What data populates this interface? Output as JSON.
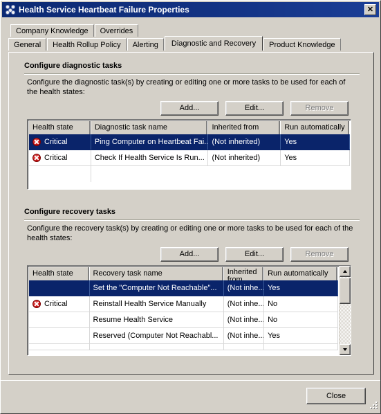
{
  "window": {
    "title": "Health Service Heartbeat Failure Properties",
    "icon": "management-pack-icon",
    "close_label": "✕"
  },
  "tabs": {
    "row1": [
      {
        "label": "Company Knowledge",
        "selected": false
      },
      {
        "label": "Overrides",
        "selected": false
      }
    ],
    "row2": [
      {
        "label": "General",
        "selected": false
      },
      {
        "label": "Health Rollup Policy",
        "selected": false
      },
      {
        "label": "Alerting",
        "selected": false
      },
      {
        "label": "Diagnostic and Recovery",
        "selected": true
      },
      {
        "label": "Product Knowledge",
        "selected": false
      }
    ]
  },
  "diagnostic": {
    "section_title": "Configure diagnostic tasks",
    "description": "Configure the diagnostic task(s) by creating or editing one or more tasks to be used for each of the health states:",
    "buttons": {
      "add": "Add...",
      "edit": "Edit...",
      "remove": "Remove"
    },
    "columns": [
      "Health state",
      "Diagnostic task name",
      "Inherited from",
      "Run automatically"
    ],
    "rows": [
      {
        "health_state": "Critical",
        "has_icon": true,
        "task_name": "Ping Computer on Heartbeat Fai...",
        "inherited_from": "(Not inherited)",
        "run_automatically": "Yes",
        "selected": true
      },
      {
        "health_state": "Critical",
        "has_icon": true,
        "task_name": "Check If Health Service Is Run...",
        "inherited_from": "(Not inherited)",
        "run_automatically": "Yes",
        "selected": false
      }
    ]
  },
  "recovery": {
    "section_title": "Configure recovery tasks",
    "description": "Configure the recovery task(s) by creating or editing one or more tasks to be used for each of the health states:",
    "buttons": {
      "add": "Add...",
      "edit": "Edit...",
      "remove": "Remove"
    },
    "columns": [
      "Health state",
      "Recovery task name",
      "Inherited from",
      "Run automatically"
    ],
    "rows": [
      {
        "health_state": "",
        "has_icon": false,
        "task_name": "Set the \"Computer Not Reachable\"...",
        "inherited_from": "(Not inhe...",
        "run_automatically": "Yes",
        "selected": true
      },
      {
        "health_state": "Critical",
        "has_icon": true,
        "task_name": "Reinstall Health Service Manually",
        "inherited_from": "(Not inhe...",
        "run_automatically": "No",
        "selected": false
      },
      {
        "health_state": "",
        "has_icon": false,
        "task_name": "Resume Health Service",
        "inherited_from": "(Not inhe...",
        "run_automatically": "No",
        "selected": false
      },
      {
        "health_state": "",
        "has_icon": false,
        "task_name": "Reserved (Computer Not Reachabl...",
        "inherited_from": "(Not inhe...",
        "run_automatically": "Yes",
        "selected": false
      }
    ],
    "scrollbar": {
      "up_arrow": "scroll-up-arrow",
      "down_arrow": "scroll-down-arrow"
    }
  },
  "footer": {
    "close_label": "Close"
  },
  "colors": {
    "face": "#d4d0c8",
    "selection": "#0a246a",
    "title_bar": "#123283",
    "critical": "#cc1111"
  }
}
